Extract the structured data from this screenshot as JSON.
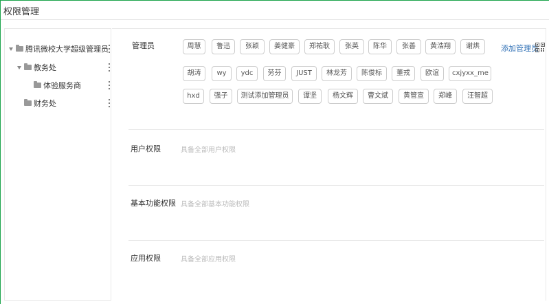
{
  "page": {
    "title": "权限管理"
  },
  "sidebar": {
    "items": [
      {
        "label": "腾讯微校大学超级管理员",
        "level": 0,
        "expanded": true
      },
      {
        "label": "教务处",
        "level": 1,
        "expanded": true
      },
      {
        "label": "体验服务商",
        "level": 2,
        "expanded": false
      },
      {
        "label": "财务处",
        "level": 1,
        "expanded": false
      }
    ]
  },
  "admins": {
    "label": "管理员",
    "add_label": "添加管理员",
    "rows": [
      [
        "周慧",
        "鲁迅",
        "张颖",
        "姜健豪",
        "郑祐耿",
        "张英",
        "陈华",
        "张善",
        "黄浩翔",
        "谢烘"
      ],
      [
        "胡涛",
        "wy",
        "ydc",
        "劳芬",
        "JUST",
        "林龙芳",
        "陈俊标",
        "董戎",
        "欧谊",
        "cxjyxx_me"
      ],
      [
        "hxd",
        "强子",
        "测试添加管理员",
        "谭坚",
        "杨文辉",
        "曹文斌",
        "黄管宣",
        "郑峰",
        "汪智超"
      ]
    ]
  },
  "sections": {
    "user": {
      "label": "用户权限",
      "placeholder": "具备全部用户权限"
    },
    "basic": {
      "label": "基本功能权限",
      "placeholder": "具备全部基本功能权限"
    },
    "app": {
      "label": "应用权限",
      "placeholder": "具备全部应用权限"
    }
  },
  "colors": {
    "link": "#2e6fb5",
    "border": "#cccccc",
    "window_edge": "#1aa34a"
  }
}
